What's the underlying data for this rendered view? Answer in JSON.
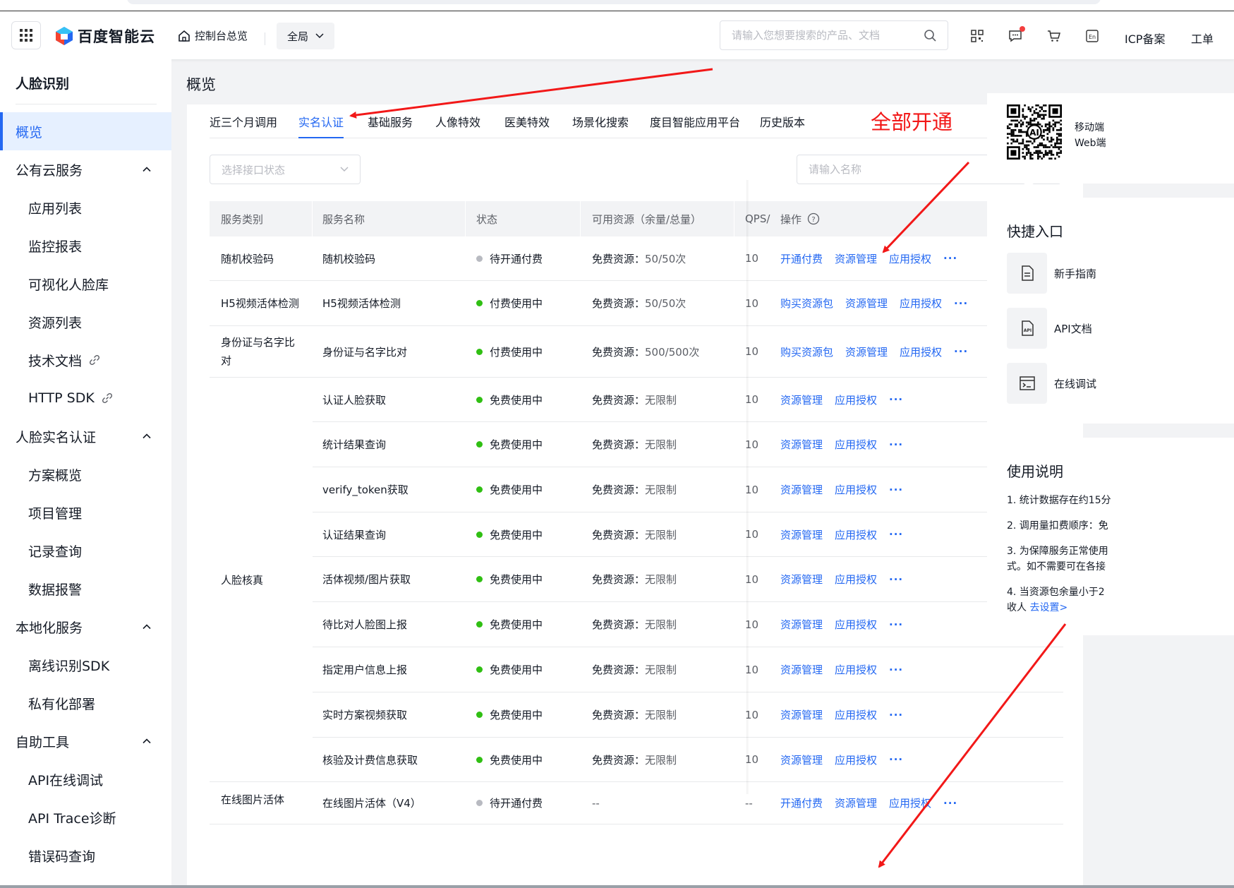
{
  "header": {
    "brand": "百度智能云",
    "console_home": "控制台总览",
    "scope": "全局",
    "search_placeholder": "请输入您想要搜索的产品、文档",
    "icp": "ICP备案",
    "ticket": "工单",
    "icons": [
      "apps-grid-icon",
      "qrcode-icon",
      "message-icon",
      "cart-icon",
      "language-icon",
      "home-icon",
      "search-icon"
    ]
  },
  "sidebar": {
    "title": "人脸识别",
    "items": [
      {
        "label": "概览",
        "level": 1,
        "active": true
      },
      {
        "label": "公有云服务",
        "level": 1,
        "collapsible": true
      },
      {
        "label": "应用列表",
        "level": 2
      },
      {
        "label": "监控报表",
        "level": 2
      },
      {
        "label": "可视化人脸库",
        "level": 2
      },
      {
        "label": "资源列表",
        "level": 2
      },
      {
        "label": "技术文档",
        "level": 2,
        "external": true
      },
      {
        "label": "HTTP SDK",
        "level": 2,
        "external": true
      },
      {
        "label": "人脸实名认证",
        "level": 1,
        "collapsible": true
      },
      {
        "label": "方案概览",
        "level": 2
      },
      {
        "label": "项目管理",
        "level": 2
      },
      {
        "label": "记录查询",
        "level": 2
      },
      {
        "label": "数据报警",
        "level": 2
      },
      {
        "label": "本地化服务",
        "level": 1,
        "collapsible": true
      },
      {
        "label": "离线识别SDK",
        "level": 2
      },
      {
        "label": "私有化部署",
        "level": 2
      },
      {
        "label": "自助工具",
        "level": 1,
        "collapsible": true
      },
      {
        "label": "API在线调试",
        "level": 2
      },
      {
        "label": "API Trace诊断",
        "level": 2
      },
      {
        "label": "错误码查询",
        "level": 2
      }
    ]
  },
  "main": {
    "page_title": "概览",
    "tabs": [
      {
        "label": "近三个月调用",
        "active": false
      },
      {
        "label": "实名认证",
        "active": true
      },
      {
        "label": "基础服务",
        "active": false
      },
      {
        "label": "人像特效",
        "active": false
      },
      {
        "label": "医美特效",
        "active": false
      },
      {
        "label": "场景化搜索",
        "active": false
      },
      {
        "label": "度目智能应用平台",
        "active": false
      },
      {
        "label": "历史版本",
        "active": false
      }
    ],
    "status_select_placeholder": "选择接口状态",
    "name_search_placeholder": "请输入名称",
    "annotation": "全部开通",
    "table": {
      "headers": [
        "服务类别",
        "服务名称",
        "状态",
        "可用资源（余量/总量）",
        "QPS/",
        "操作"
      ],
      "resource_prefix": "免费资源：",
      "groups": [
        {
          "category": "随机校验码",
          "rows": [
            0
          ]
        },
        {
          "category": "H5视频活体检测",
          "rows": [
            1
          ]
        },
        {
          "category": "身份证与名字比对",
          "rows": [
            2
          ]
        },
        {
          "category": "人脸核真",
          "rows": [
            3,
            4,
            5,
            6,
            7,
            8,
            9,
            10,
            11
          ]
        },
        {
          "category": "在线图片活体",
          "rows": [
            12
          ]
        }
      ],
      "rows": [
        {
          "name": "随机校验码",
          "status": "待开通付费",
          "status_color": "#b8bac1",
          "resource": "50/50次",
          "qps": "10",
          "actions": [
            "开通付费",
            "资源管理",
            "应用授权"
          ]
        },
        {
          "name": "H5视频活体检测",
          "status": "付费使用中",
          "status_color": "#30bf13",
          "resource": "50/50次",
          "qps": "10",
          "actions": [
            "购买资源包",
            "资源管理",
            "应用授权"
          ]
        },
        {
          "name": "身份证与名字比对",
          "status": "付费使用中",
          "status_color": "#30bf13",
          "resource": "500/500次",
          "qps": "10",
          "actions": [
            "购买资源包",
            "资源管理",
            "应用授权"
          ]
        },
        {
          "name": "认证人脸获取",
          "status": "免费使用中",
          "status_color": "#30bf13",
          "resource": "无限制",
          "qps": "10",
          "actions": [
            "资源管理",
            "应用授权"
          ]
        },
        {
          "name": "统计结果查询",
          "status": "免费使用中",
          "status_color": "#30bf13",
          "resource": "无限制",
          "qps": "10",
          "actions": [
            "资源管理",
            "应用授权"
          ]
        },
        {
          "name": "verify_token获取",
          "status": "免费使用中",
          "status_color": "#30bf13",
          "resource": "无限制",
          "qps": "10",
          "actions": [
            "资源管理",
            "应用授权"
          ]
        },
        {
          "name": "认证结果查询",
          "status": "免费使用中",
          "status_color": "#30bf13",
          "resource": "无限制",
          "qps": "10",
          "actions": [
            "资源管理",
            "应用授权"
          ]
        },
        {
          "name": "活体视频/图片获取",
          "status": "免费使用中",
          "status_color": "#30bf13",
          "resource": "无限制",
          "qps": "10",
          "actions": [
            "资源管理",
            "应用授权"
          ]
        },
        {
          "name": "待比对人脸图上报",
          "status": "免费使用中",
          "status_color": "#30bf13",
          "resource": "无限制",
          "qps": "10",
          "actions": [
            "资源管理",
            "应用授权"
          ]
        },
        {
          "name": "指定用户信息上报",
          "status": "免费使用中",
          "status_color": "#30bf13",
          "resource": "无限制",
          "qps": "10",
          "actions": [
            "资源管理",
            "应用授权"
          ]
        },
        {
          "name": "实时方案视频获取",
          "status": "免费使用中",
          "status_color": "#30bf13",
          "resource": "无限制",
          "qps": "10",
          "actions": [
            "资源管理",
            "应用授权"
          ]
        },
        {
          "name": "核验及计费信息获取",
          "status": "免费使用中",
          "status_color": "#30bf13",
          "resource": "无限制",
          "qps": "10",
          "actions": [
            "资源管理",
            "应用授权"
          ]
        },
        {
          "name": "在线图片活体（V4）",
          "status": "待开通付费",
          "status_color": "#b8bac1",
          "resource": "--",
          "qps": "--",
          "actions": [
            "开通付费",
            "资源管理",
            "应用授权"
          ]
        }
      ]
    }
  },
  "right_panel": {
    "qr_labels": [
      "移动端",
      "Web端"
    ],
    "quick_entry_title": "快捷入口",
    "quick_entries": [
      {
        "label": "新手指南",
        "icon": "document-icon"
      },
      {
        "label": "API文档",
        "icon": "api-doc-icon"
      },
      {
        "label": "在线调试",
        "icon": "terminal-icon"
      }
    ],
    "usage_title": "使用说明",
    "notes": [
      "1. 统计数据存在约15分",
      "2. 调用量扣费顺序：免",
      "3. 为保障服务正常使用",
      "式。如不需要可在各接",
      "4. 当资源包余量小于2",
      "收人"
    ],
    "notes_link": "去设置>"
  }
}
